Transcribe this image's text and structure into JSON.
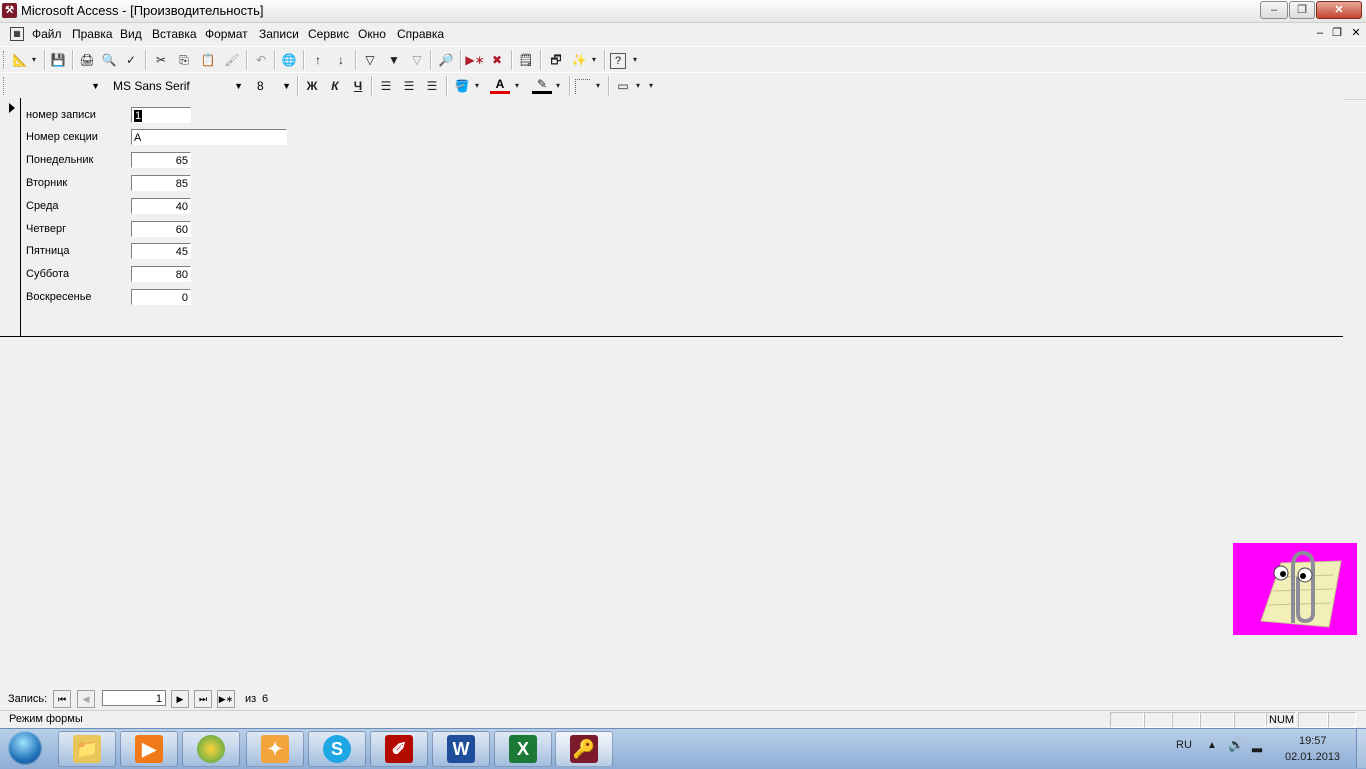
{
  "window": {
    "title": "Microsoft Access - [Производительность]"
  },
  "menu": {
    "items": [
      "Файл",
      "Правка",
      "Вид",
      "Вставка",
      "Формат",
      "Записи",
      "Сервис",
      "Окно",
      "Справка"
    ]
  },
  "format_toolbar": {
    "object_value": "",
    "font_name": "MS Sans Serif",
    "font_size": "8",
    "bold": "Ж",
    "italic": "К",
    "underline": "Ч"
  },
  "form": {
    "fields": [
      {
        "label": "номер записи",
        "value": "1"
      },
      {
        "label": "Номер секции",
        "value": "A"
      },
      {
        "label": "Понедельник",
        "value": "65"
      },
      {
        "label": "Вторник",
        "value": "85"
      },
      {
        "label": "Среда",
        "value": "40"
      },
      {
        "label": "Четверг",
        "value": "60"
      },
      {
        "label": "Пятница",
        "value": "45"
      },
      {
        "label": "Суббота",
        "value": "80"
      },
      {
        "label": "Воскресенье",
        "value": "0"
      }
    ]
  },
  "navigation": {
    "label": "Запись:",
    "current": "1",
    "of_label": "из",
    "total": "6"
  },
  "status": {
    "mode": "Режим формы",
    "num_indicator": "NUM"
  },
  "taskbar": {
    "apps": [
      "explorer-icon",
      "media-player-icon",
      "browser-icon",
      "paint-icon",
      "skype-icon",
      "acrobat-icon",
      "word-icon",
      "excel-icon",
      "access-icon"
    ],
    "language": "RU",
    "time": "19:57",
    "date": "02.01.2013"
  },
  "colors": {
    "assistant_bg": "#ff00ff",
    "title_accent": "#7a1a2a"
  }
}
